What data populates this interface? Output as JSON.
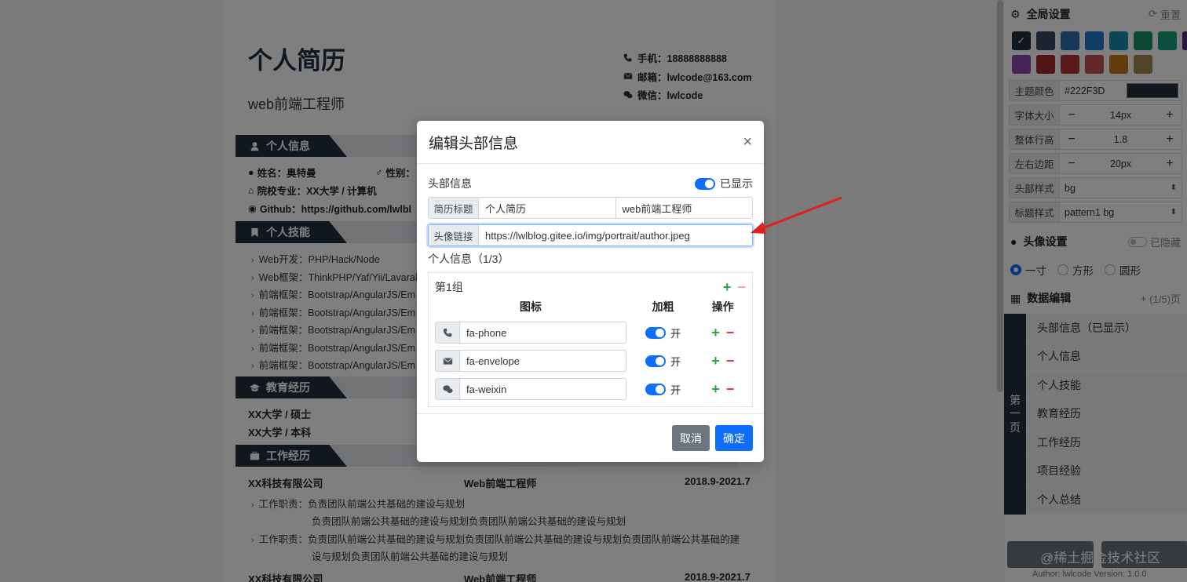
{
  "resume": {
    "title": "个人简历",
    "subtitle": "web前端工程师",
    "contacts": [
      {
        "icon": "phone-icon",
        "label": "手机：18888888888"
      },
      {
        "icon": "envelope-icon",
        "label": "邮箱：lwlcode@163.com"
      },
      {
        "icon": "wechat-icon",
        "label": "微信：lwlcode"
      }
    ],
    "sections": {
      "info": "个人信息",
      "skills": "个人技能",
      "education": "教育经历",
      "work": "工作经历"
    },
    "info": {
      "name": "姓名：奥特曼",
      "gender": "性别：",
      "school": "院校专业：XX大学 / 计算机",
      "github": "Github：https://github.com/lwlbl"
    },
    "skills": [
      "Web开发：PHP/Hack/Node",
      "Web框架：ThinkPHP/Yaf/Yii/Lavaral",
      "前端框架：Bootstrap/AngularJS/Em",
      "前端框架：Bootstrap/AngularJS/Em",
      "前端框架：Bootstrap/AngularJS/Em",
      "前端框架：Bootstrap/AngularJS/Em",
      "前端框架：Bootstrap/AngularJS/Em"
    ],
    "education": [
      "XX大学 / 硕士",
      "XX大学 / 本科"
    ],
    "work": {
      "company": "XX科技有限公司",
      "position": "Web前端工程师",
      "period": "2018.9-2021.7",
      "lines": [
        "工作职责：负责团队前端公共基础的建设与规划",
        "负责团队前端公共基础的建设与规划负责团队前端公共基础的建设与规划",
        "工作职责：负责团队前端公共基础的建设与规划负责团队前端公共基础的建设与规划负责团队前端公共基础的建",
        "设与规划负责团队前端公共基础的建设与规划"
      ],
      "company2": "XX科技有限公司",
      "position2": "Web前端工程师",
      "period2": "2018.9-2021.7"
    }
  },
  "modal": {
    "title": "编辑头部信息",
    "close": "×",
    "header_label": "头部信息",
    "shown_label": "已显示",
    "resume_title_label": "简历标题",
    "resume_title_value": "个人简历",
    "resume_sub_value": "web前端工程师",
    "avatar_label": "头像链接",
    "avatar_value": "https://lwlblog.gitee.io/img/portrait/author.jpeg",
    "personal_label": "个人信息（1/3）",
    "group_title": "第1组",
    "col_icon": "图标",
    "col_bold": "加粗",
    "col_action": "操作",
    "rows": [
      {
        "icon": "phone-icon",
        "value": "fa-phone",
        "bold": "开"
      },
      {
        "icon": "envelope-icon",
        "value": "fa-envelope",
        "bold": "开"
      },
      {
        "icon": "wechat-icon",
        "value": "fa-weixin",
        "bold": "开"
      }
    ],
    "cancel": "取消",
    "confirm": "确定"
  },
  "panel": {
    "global_title": "全局设置",
    "reset": "重置",
    "swatch_colors": [
      "#222F3D",
      "#34495e",
      "#2c6fb0",
      "#1e76c8",
      "#1a8faf",
      "#17936b",
      "#1a9e7f",
      "#5b2c83",
      "#8e44ad",
      "#9e2a2a",
      "#b53131",
      "#c25454",
      "#c2791a",
      "#a0884a"
    ],
    "theme_color_label": "主题颜色",
    "theme_color_value": "#222F3D",
    "font_size_label": "字体大小",
    "font_size_value": "14px",
    "line_height_label": "整体行高",
    "line_height_value": "1.8",
    "margin_label": "左右边距",
    "margin_value": "20px",
    "header_style_label": "头部样式",
    "header_style_value": "bg",
    "title_style_label": "标题样式",
    "title_style_value": "pattern1 bg",
    "avatar_title": "头像设置",
    "avatar_hidden": "已隐藏",
    "avatar_options": [
      "一寸",
      "方形",
      "圆形"
    ],
    "data_title": "数据编辑",
    "data_count": "(1/5)页",
    "page_label_chars": [
      "第",
      "一",
      "页"
    ],
    "page_items": [
      "头部信息（已显示）",
      "个人信息",
      "个人技能",
      "教育经历",
      "工作经历",
      "项目经验",
      "个人总结"
    ],
    "footer_btn1": "↓",
    "watermark": "@稀土掘金技术社区",
    "author": "Author: lwlcode Version: 1.0.0"
  }
}
